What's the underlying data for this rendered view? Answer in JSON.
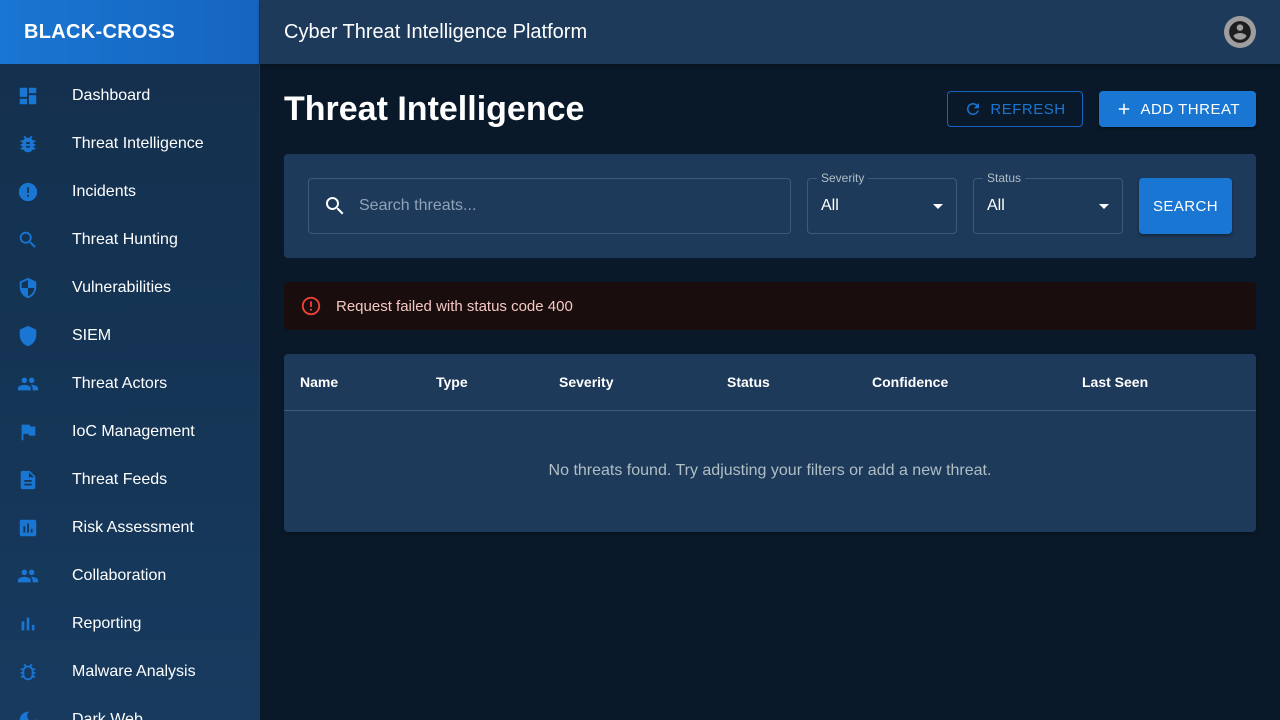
{
  "brand": "BLACK-CROSS",
  "topbar": {
    "title": "Cyber Threat Intelligence Platform"
  },
  "sidebar": {
    "items": [
      {
        "label": "Dashboard",
        "icon": "dashboard-icon"
      },
      {
        "label": "Threat Intelligence",
        "icon": "bug-icon"
      },
      {
        "label": "Incidents",
        "icon": "error-icon"
      },
      {
        "label": "Threat Hunting",
        "icon": "search-icon"
      },
      {
        "label": "Vulnerabilities",
        "icon": "shield-half-icon"
      },
      {
        "label": "SIEM",
        "icon": "shield-icon"
      },
      {
        "label": "Threat Actors",
        "icon": "people-icon"
      },
      {
        "label": "IoC Management",
        "icon": "flag-icon"
      },
      {
        "label": "Threat Feeds",
        "icon": "description-icon"
      },
      {
        "label": "Risk Assessment",
        "icon": "assessment-icon"
      },
      {
        "label": "Collaboration",
        "icon": "people-icon"
      },
      {
        "label": "Reporting",
        "icon": "bar-chart-icon"
      },
      {
        "label": "Malware Analysis",
        "icon": "bug-icon"
      },
      {
        "label": "Dark Web",
        "icon": "moon-icon"
      }
    ]
  },
  "page": {
    "title": "Threat Intelligence",
    "refresh_label": "REFRESH",
    "add_label": "ADD THREAT"
  },
  "filters": {
    "search_placeholder": "Search threats...",
    "severity_label": "Severity",
    "severity_value": "All",
    "status_label": "Status",
    "status_value": "All",
    "search_button": "SEARCH"
  },
  "alert": {
    "message": "Request failed with status code 400"
  },
  "table": {
    "columns": [
      "Name",
      "Type",
      "Severity",
      "Status",
      "Confidence",
      "Last Seen"
    ],
    "empty_message": "No threats found. Try adjusting your filters or add a new threat."
  }
}
